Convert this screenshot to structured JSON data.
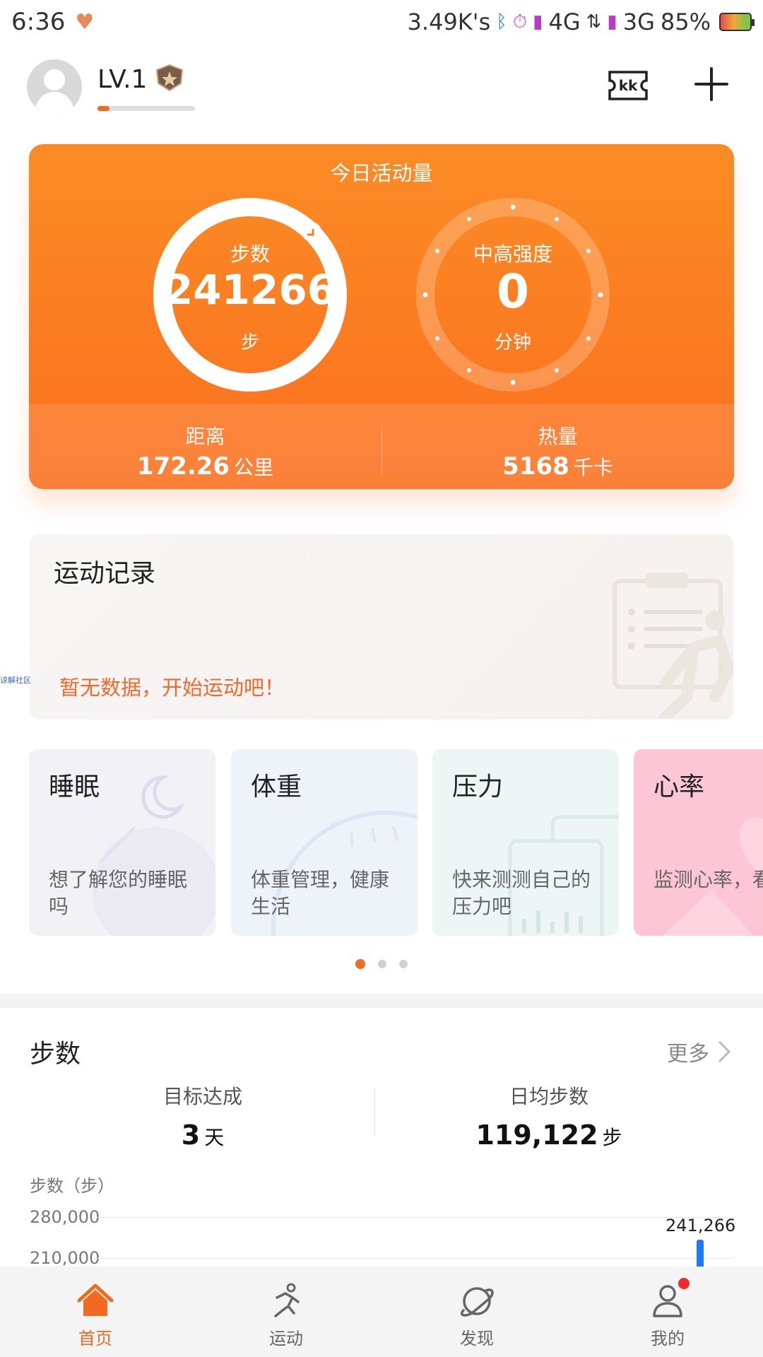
{
  "status_bar": {
    "time": "6:36",
    "speed": "3.49K's",
    "net1": "4G",
    "net2": "3G",
    "battery": "85%"
  },
  "header": {
    "level": "LV.1",
    "level_progress": 0.12,
    "ticket_text": "kk"
  },
  "activity": {
    "title": "今日活动量",
    "steps": {
      "label": "步数",
      "value": "241266",
      "unit": "步"
    },
    "intensity": {
      "label": "中高强度",
      "value": "0",
      "unit": "分钟"
    },
    "distance": {
      "label": "距离",
      "value": "172.26",
      "unit": "公里"
    },
    "calories": {
      "label": "热量",
      "value": "5168",
      "unit": "千卡"
    }
  },
  "record": {
    "title": "运动记录",
    "empty_text": "暂无数据，开始运动吧！",
    "side_tag": "谅解社区"
  },
  "cards": [
    {
      "title": "睡眠",
      "desc": "想了解您的睡眠吗"
    },
    {
      "title": "体重",
      "desc": "体重管理，健康生活"
    },
    {
      "title": "压力",
      "desc": "快来测测自己的压力吧"
    },
    {
      "title": "心率",
      "desc": "监测心率，看护您的健"
    }
  ],
  "steps_section": {
    "title": "步数",
    "more": "更多",
    "goal_label": "目标达成",
    "goal_value": "3",
    "goal_unit": "天",
    "avg_label": "日均步数",
    "avg_value": "119,122",
    "avg_unit": "步"
  },
  "chart_data": {
    "type": "bar",
    "ylabel": "步数（步）",
    "yticks": [
      "280,000",
      "210,000"
    ],
    "ylim": [
      0,
      280000
    ],
    "values": [
      241266
    ],
    "value_labels": [
      "241,266"
    ]
  },
  "nav": [
    {
      "label": "首页",
      "active": true
    },
    {
      "label": "运动",
      "active": false
    },
    {
      "label": "发现",
      "active": false
    },
    {
      "label": "我的",
      "active": false
    }
  ],
  "colors": {
    "accent": "#f26a1f",
    "card_orange": "#fb7f22",
    "bar_blue": "#1e7cf2"
  }
}
